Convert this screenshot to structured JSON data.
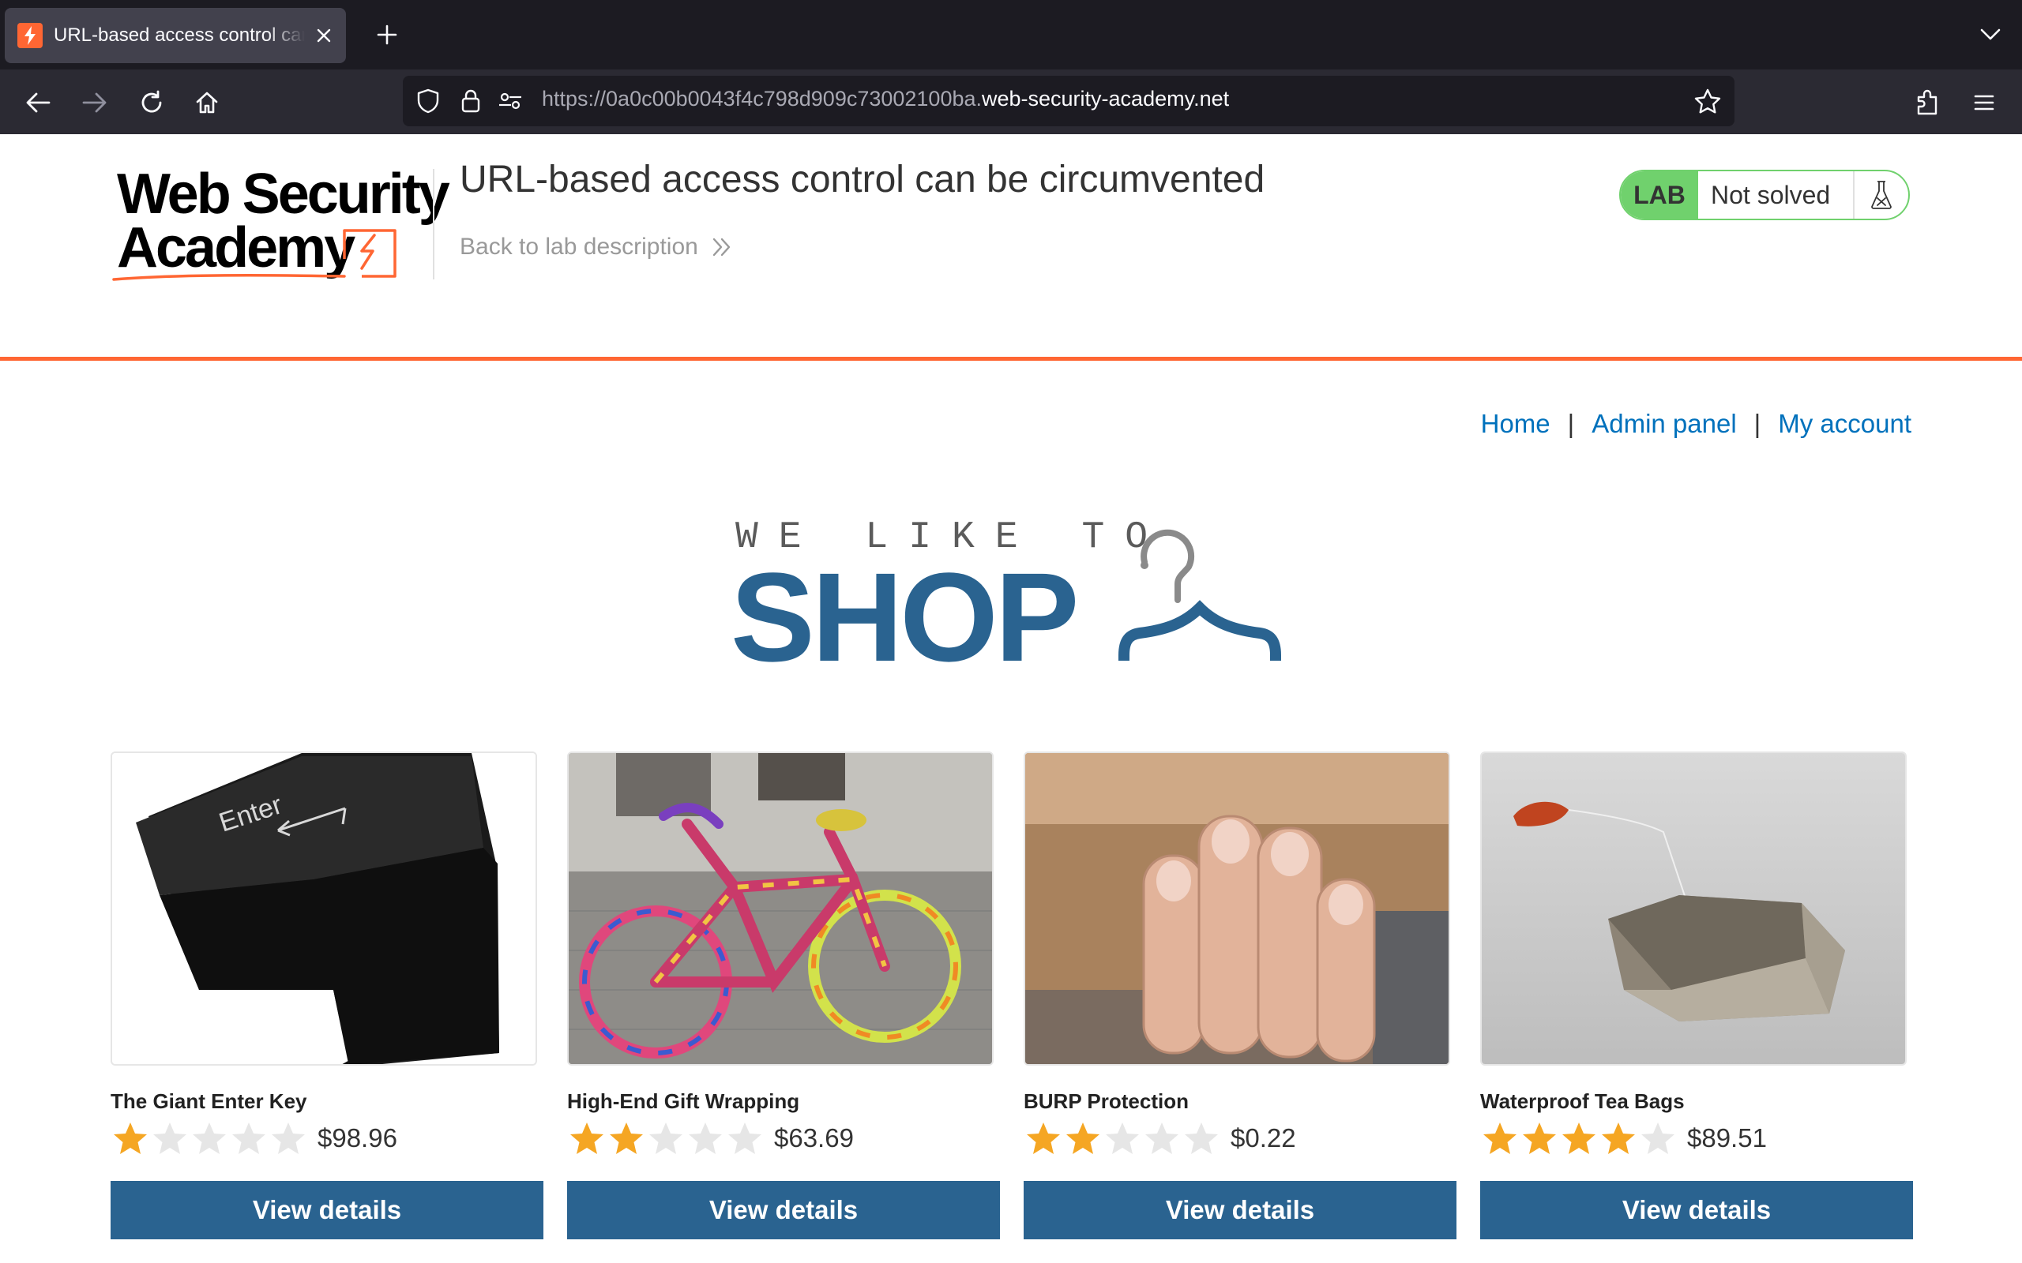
{
  "browser": {
    "tab_title": "URL-based access control can be circumvented",
    "url_host_prefix": "https://0a0c00b0043f4c798d909c73002100ba.",
    "url_host_domain": "web-security-academy.net",
    "icons": [
      "back-icon",
      "forward-icon",
      "reload-icon",
      "home-icon",
      "shield-icon",
      "lock-icon",
      "permissions-icon",
      "bookmark-star-icon",
      "extensions-icon",
      "menu-icon",
      "new-tab-icon",
      "close-icon",
      "tab-list-icon"
    ]
  },
  "lab_header": {
    "logo_line1": "Web Security",
    "logo_line2": "Academy",
    "title": "URL-based access control can be circumvented",
    "back_link": "Back to lab description",
    "status_badge": "LAB",
    "status_text": "Not solved",
    "accent_color": "#ff6633",
    "status_color": "#70d16d"
  },
  "nav": {
    "home": "Home",
    "separator": "|",
    "admin_panel": "Admin panel",
    "my_account": "My account"
  },
  "banner": {
    "small": "WE LIKE TO",
    "big": "SHOP",
    "color": "#2a6390"
  },
  "products": [
    {
      "name": "The Giant Enter Key",
      "rating": 1,
      "price": "$98.96",
      "button": "View details",
      "image": "giant-enter-key-image"
    },
    {
      "name": "High-End Gift Wrapping",
      "rating": 2,
      "price": "$63.69",
      "button": "View details",
      "image": "knitted-bicycle-image"
    },
    {
      "name": "BURP Protection",
      "rating": 2,
      "price": "$0.22",
      "button": "View details",
      "image": "hand-over-mouth-image"
    },
    {
      "name": "Waterproof Tea Bags",
      "rating": 4,
      "price": "$89.51",
      "button": "View details",
      "image": "tea-bag-image"
    }
  ]
}
